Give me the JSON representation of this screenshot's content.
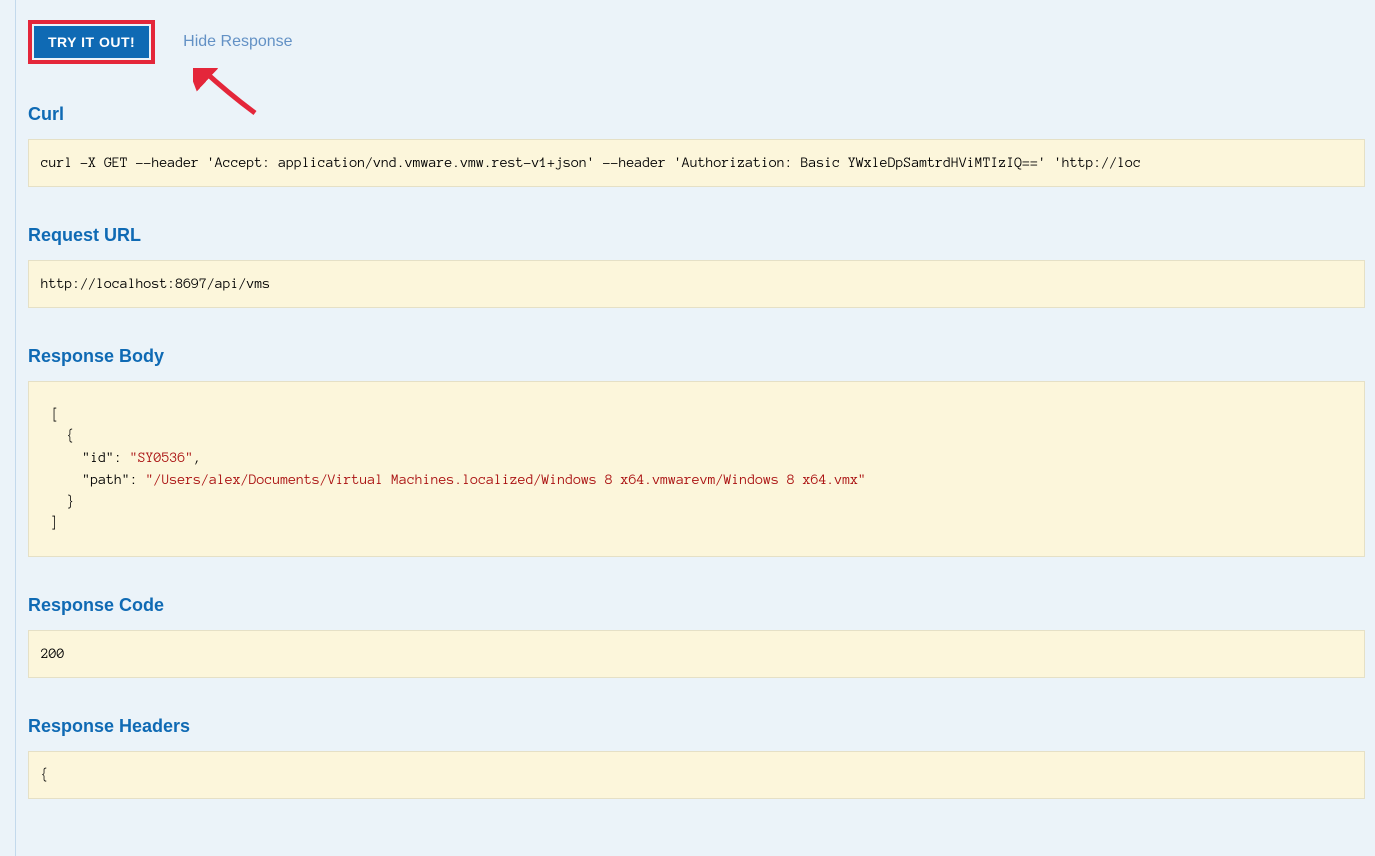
{
  "actions": {
    "try_button_label": "TRY IT OUT!",
    "hide_response_label": "Hide Response"
  },
  "sections": {
    "curl": {
      "title": "Curl",
      "content": "curl -X GET --header 'Accept: application/vnd.vmware.vmw.rest-v1+json' --header 'Authorization: Basic YWxleDpSamtrdHViMTIzIQ==' 'http://loc"
    },
    "request_url": {
      "title": "Request URL",
      "content": "http://localhost:8697/api/vms"
    },
    "response_body": {
      "title": "Response Body",
      "json_open_bracket": "[",
      "json_open_brace": "  {",
      "id_key": "    \"id\": ",
      "id_value": "\"SY0536\"",
      "id_comma": ",",
      "path_key": "    \"path\": ",
      "path_value": "\"/Users/alex/Documents/Virtual Machines.localized/Windows 8 x64.vmwarevm/Windows 8 x64.vmx\"",
      "json_close_brace": "  }",
      "json_close_bracket": "]"
    },
    "response_code": {
      "title": "Response Code",
      "content": "200"
    },
    "response_headers": {
      "title": "Response Headers",
      "content": "{"
    }
  }
}
